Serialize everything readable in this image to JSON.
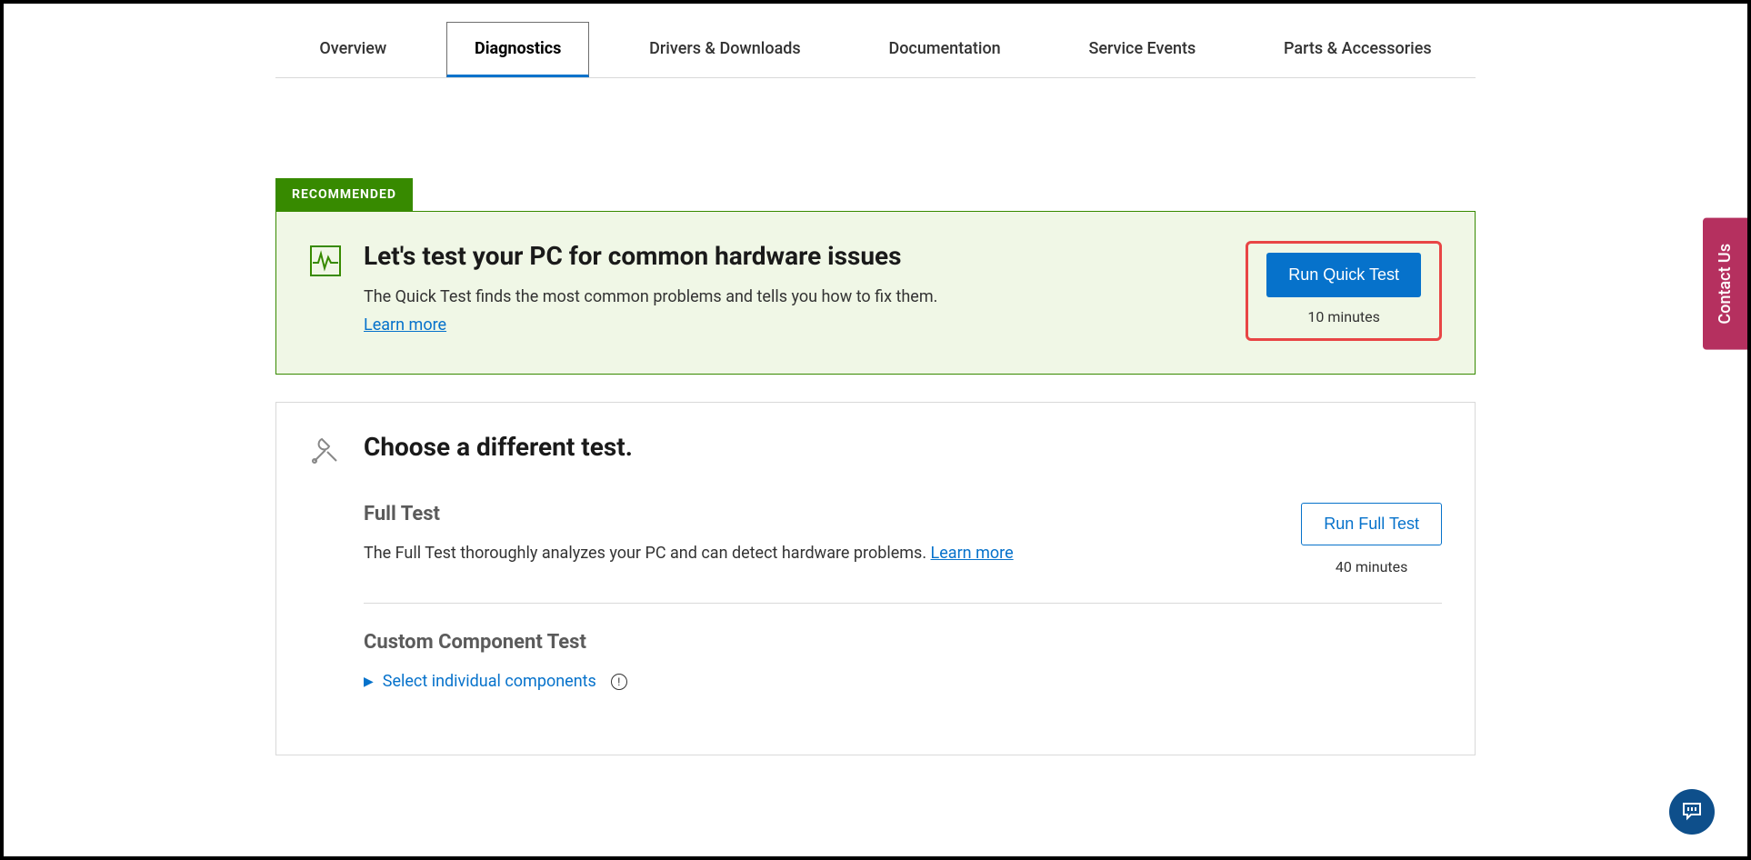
{
  "tabs": {
    "overview": "Overview",
    "diagnostics": "Diagnostics",
    "drivers": "Drivers & Downloads",
    "documentation": "Documentation",
    "service_events": "Service Events",
    "parts": "Parts & Accessories"
  },
  "recommended": {
    "badge": "RECOMMENDED",
    "title": "Let's test your PC for common hardware issues",
    "desc": "The Quick Test finds the most common problems and tells you how to fix them.",
    "learn_more": "Learn more",
    "button": "Run Quick Test",
    "duration": "10 minutes"
  },
  "alternate": {
    "title": "Choose a different test.",
    "full_test": {
      "name": "Full Test",
      "desc": "The Full Test thoroughly analyzes your PC and can detect hardware problems. ",
      "learn_more": "Learn more",
      "button": "Run Full Test",
      "duration": "40 minutes"
    },
    "custom_test": {
      "name": "Custom Component Test",
      "select_label": "Select individual components"
    }
  },
  "contact_tab": "Contact Us"
}
